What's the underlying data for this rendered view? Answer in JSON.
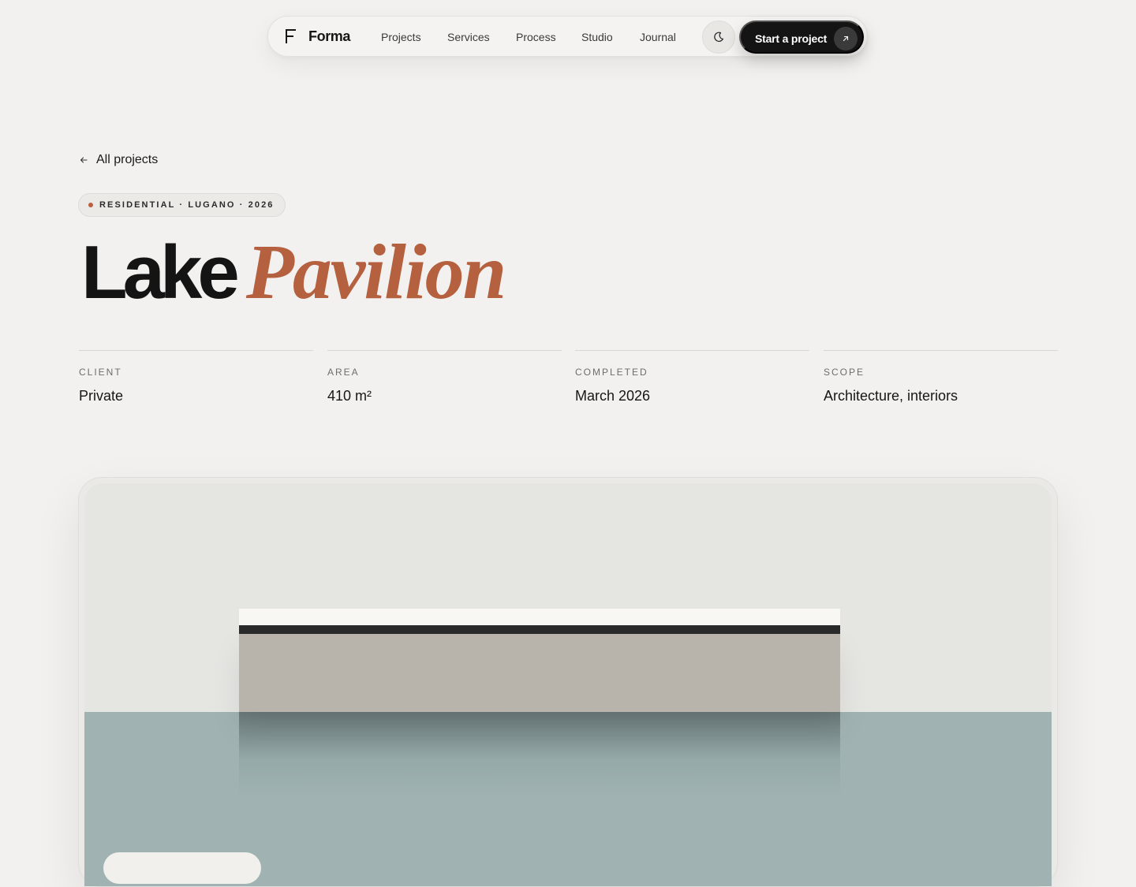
{
  "nav": {
    "brand": "Forma",
    "links": [
      "Projects",
      "Services",
      "Process",
      "Studio",
      "Journal"
    ],
    "theme_toggle_icon": "moon-icon",
    "cta_label": "Start a project",
    "cta_icon": "arrow-up-right-icon"
  },
  "back_link": {
    "label": "All projects",
    "icon": "arrow-left-icon"
  },
  "project": {
    "tag": "RESIDENTIAL · LUGANO · 2026",
    "title_plain": "Lake",
    "title_accent": "Pavilion",
    "accent_color": "#b5603e"
  },
  "meta": [
    {
      "label": "CLIENT",
      "value": "Private"
    },
    {
      "label": "AREA",
      "value": "410 m²"
    },
    {
      "label": "COMPLETED",
      "value": "March 2026"
    },
    {
      "label": "SCOPE",
      "value": "Architecture, interiors"
    }
  ]
}
